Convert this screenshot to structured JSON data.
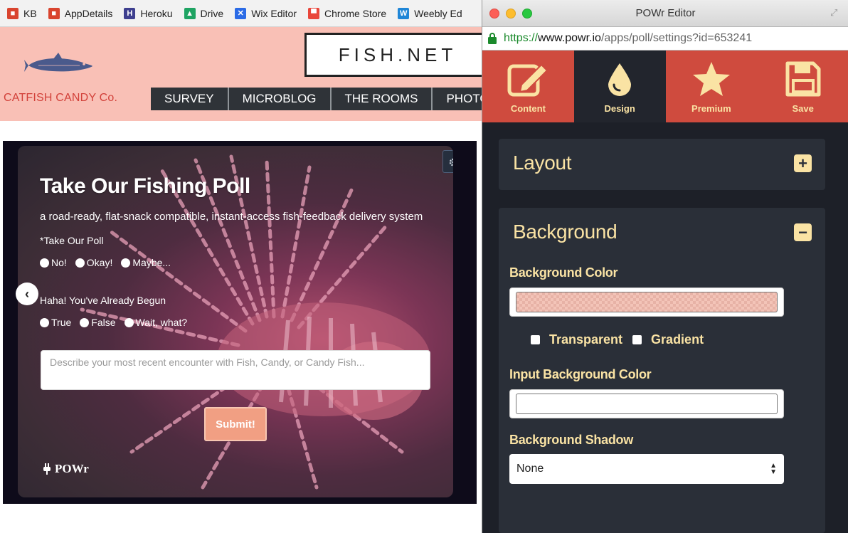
{
  "bookmarks": [
    {
      "label": "KB",
      "color": "#d9442e",
      "glyph": "■"
    },
    {
      "label": "AppDetails",
      "color": "#d9442e",
      "glyph": "■"
    },
    {
      "label": "Heroku",
      "color": "#3e3f8f",
      "glyph": "H"
    },
    {
      "label": "Drive",
      "color": "#1fa463",
      "glyph": "▲"
    },
    {
      "label": "Wix Editor",
      "color": "#2b6be6",
      "glyph": "✕"
    },
    {
      "label": "Chrome Store",
      "color": "#e9463a",
      "glyph": "▀"
    },
    {
      "label": "Weebly Ed",
      "color": "#1f86d7",
      "glyph": "W"
    }
  ],
  "site": {
    "title": "FISH.NET",
    "brand": "CATFISH CANDY Co.",
    "nav": [
      "SURVEY",
      "MICROBLOG",
      "THE ROOMS",
      "PHOTO"
    ],
    "header_bg": "#f9c0b6"
  },
  "poll": {
    "title": "Take Our Fishing Poll",
    "subtitle": "a road-ready, flat-snack compatible, instant-access fish-feedback delivery system",
    "q1_label": "*Take Our Poll",
    "q1_options": [
      "No!",
      "Okay!",
      "Maybe..."
    ],
    "q2_label": "Haha! You've Already Begun",
    "q2_options": [
      "True",
      "False",
      "Wait, what?"
    ],
    "input_placeholder": "Describe your most recent encounter with Fish, Candy, or Candy Fish...",
    "submit_label": "Submit!",
    "logo": "POWr"
  },
  "editor": {
    "window_title": "POWr Editor",
    "url": {
      "protocol": "https://",
      "host": "www.powr.io",
      "path": "/apps/poll/settings?id=653241"
    },
    "tabs": [
      {
        "label": "Content",
        "icon": "edit-icon",
        "active": false
      },
      {
        "label": "Design",
        "icon": "drop-icon",
        "active": true
      },
      {
        "label": "Premium",
        "icon": "star-icon",
        "active": false
      },
      {
        "label": "Save",
        "icon": "save-icon",
        "active": false
      }
    ],
    "layout_section": {
      "title": "Layout",
      "state": "collapsed"
    },
    "background_section": {
      "title": "Background",
      "state": "expanded",
      "bg_color_label": "Background Color",
      "bg_color_value": "#f3c4b8",
      "transparent_label": "Transparent",
      "gradient_label": "Gradient",
      "input_bg_label": "Input Background Color",
      "input_bg_value": "#ffffff",
      "shadow_label": "Background Shadow",
      "shadow_value": "None"
    },
    "accent": "#cf4b3e",
    "label_color": "#fae3a4"
  }
}
